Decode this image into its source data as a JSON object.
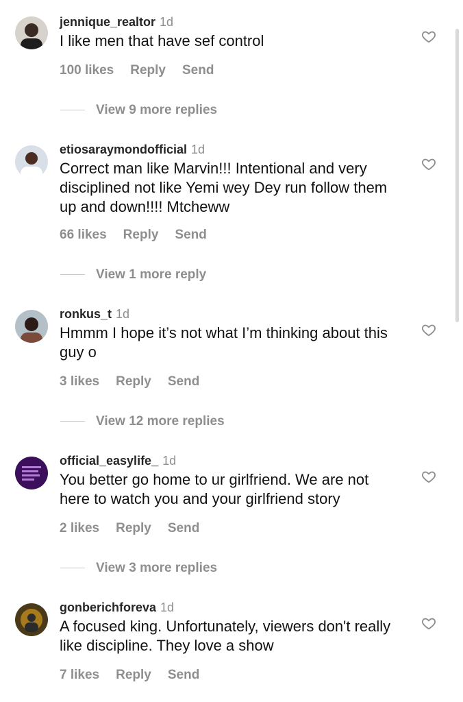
{
  "colors": {
    "username": "#262626",
    "muted": "#8e8e8e",
    "text": "#111111",
    "divider": "#c8c8c8",
    "scrollbar": "#d9d9d9"
  },
  "icons": {
    "like": "heart-outline"
  },
  "comments": [
    {
      "username": "jennique_realtor",
      "time": "1d",
      "text": "I like men that have sef control",
      "likes": "100 likes",
      "reply": "Reply",
      "send": "Send",
      "more_replies": "View 9 more replies"
    },
    {
      "username": "etiosaraymondofficial",
      "time": "1d",
      "text": "Correct man like Marvin!!! Intentional and very disciplined not like Yemi wey Dey run follow them up and down!!!! Mtcheww",
      "likes": "66 likes",
      "reply": "Reply",
      "send": "Send",
      "more_replies": "View 1 more reply"
    },
    {
      "username": "ronkus_t",
      "time": "1d",
      "text": "Hmmm I hope it’s not what I’m thinking about this guy o",
      "likes": "3 likes",
      "reply": "Reply",
      "send": "Send",
      "more_replies": "View 12 more replies"
    },
    {
      "username": "official_easylife_",
      "time": "1d",
      "text": "You better go home to ur girlfriend. We are not here to watch you and your girlfriend story",
      "likes": "2 likes",
      "reply": "Reply",
      "send": "Send",
      "more_replies": "View 3 more replies"
    },
    {
      "username": "gonberichforeva",
      "time": "1d",
      "text": "A focused king. Unfortunately, viewers don't really like discipline. They love a show",
      "likes": "7 likes",
      "reply": "Reply",
      "send": "Send"
    }
  ]
}
